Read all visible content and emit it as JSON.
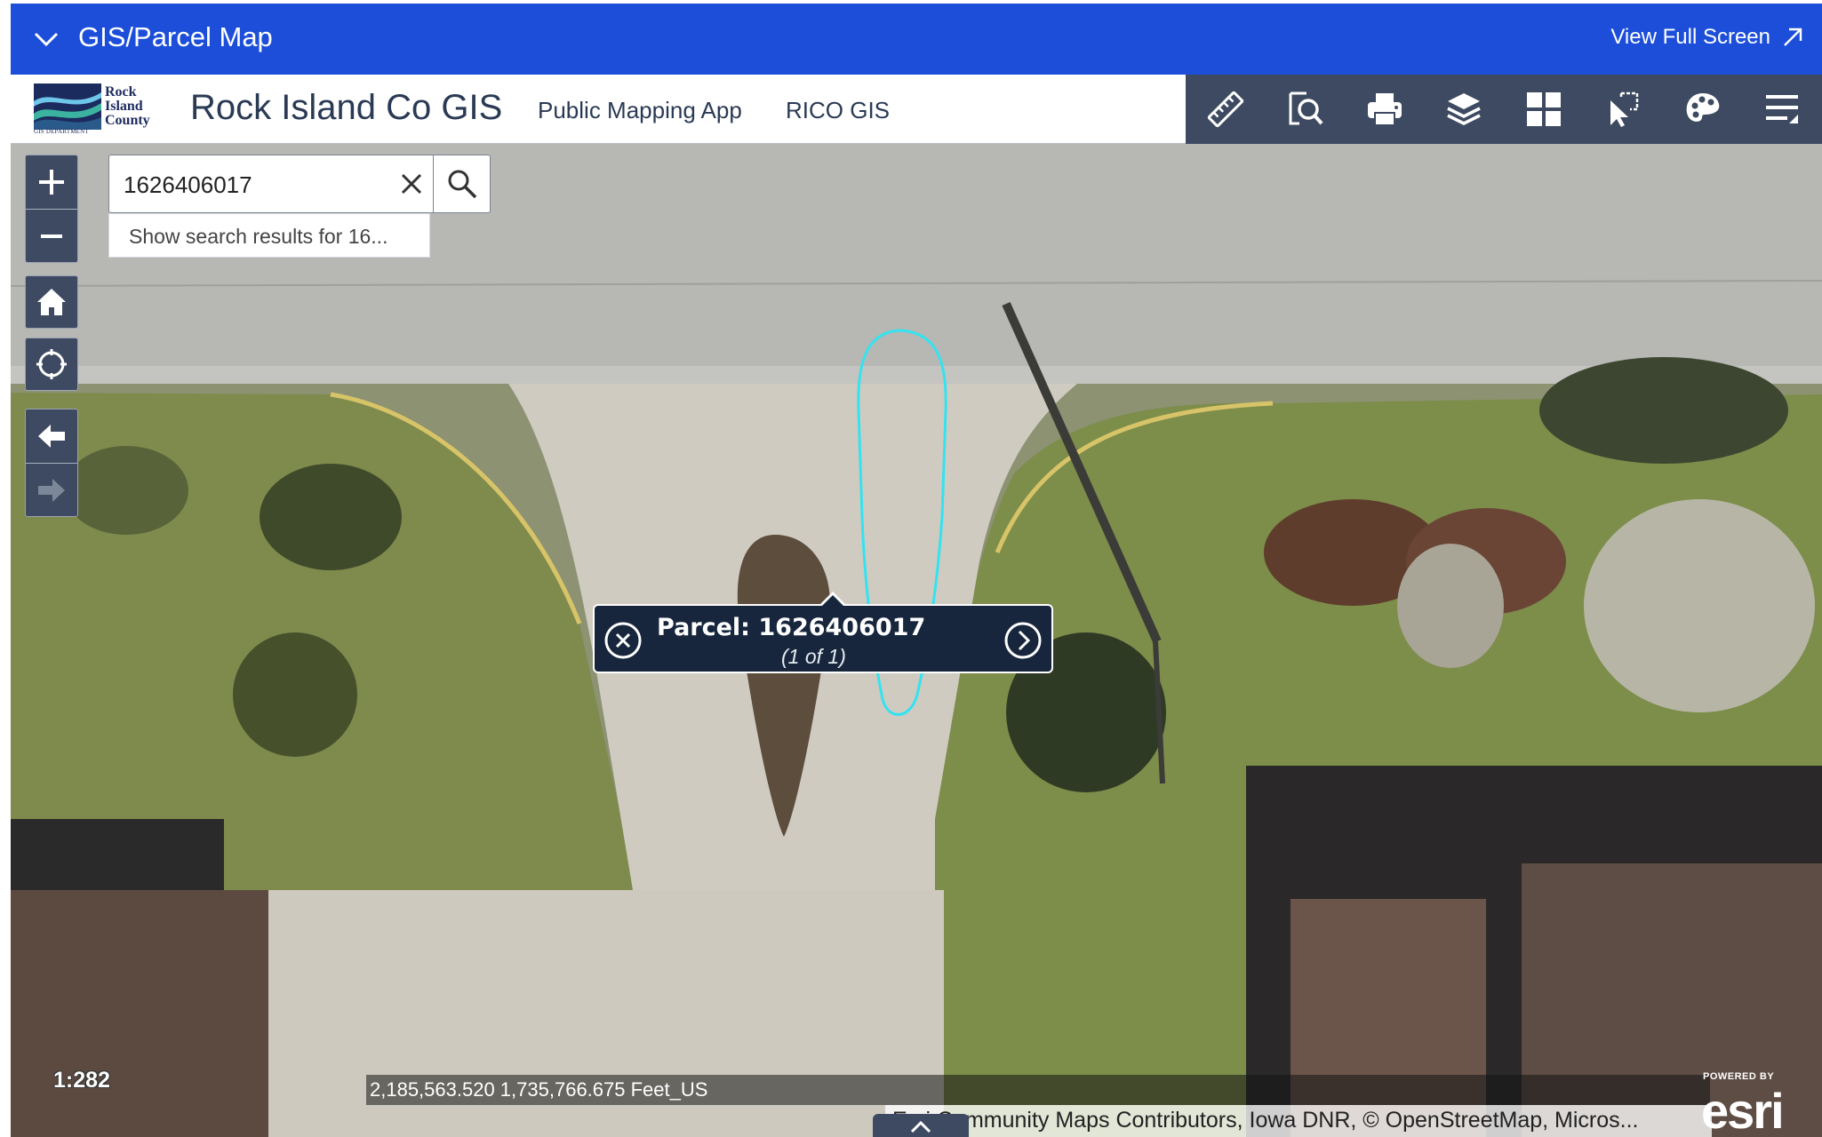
{
  "topbar": {
    "title": "GIS/Parcel Map",
    "full_screen": "View Full Screen"
  },
  "header": {
    "logo_lines": [
      "Rock",
      "Island",
      "County"
    ],
    "logo_dept": "GIS DEPARTMENT",
    "app_title": "Rock Island Co GIS",
    "nav": [
      "Public Mapping App",
      "RICO GIS"
    ]
  },
  "toolbar": {
    "tools": [
      "ruler-icon",
      "search-zoom-icon",
      "print-icon",
      "layers-icon",
      "grid-icon",
      "select-icon",
      "palette-icon",
      "menu-icon"
    ]
  },
  "search": {
    "value": "1626406017",
    "suggestion": "Show search results for 16..."
  },
  "popup": {
    "title": "Parcel: 1626406017",
    "count": "(1 of 1)"
  },
  "map": {
    "scale": "1:282",
    "coordinates": "2,185,563.520 1,735,766.675 Feet_US",
    "attribution": "Esri Community Maps Contributors, Iowa DNR, © OpenStreetMap, Micros...",
    "powered_by": "POWERED BY",
    "esri": "esri",
    "selection_color": "#34e3f0",
    "accent": "#1c4ed9",
    "toolbar_bg": "#3d4a61"
  }
}
